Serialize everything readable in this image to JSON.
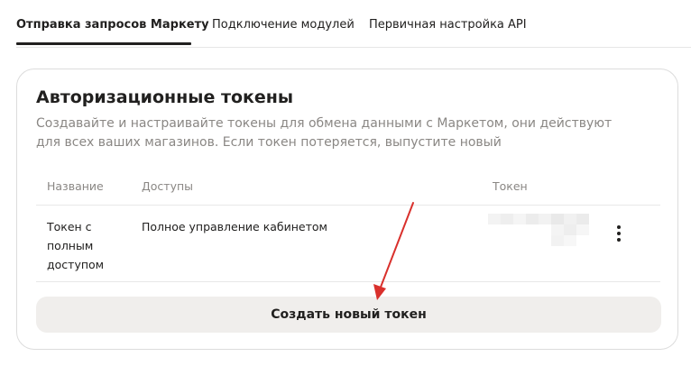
{
  "tabs": [
    {
      "label": "Отправка запросов Маркету",
      "active": true
    },
    {
      "label": "Подключение модулей",
      "active": false
    },
    {
      "label": "Первичная настройка API",
      "active": false
    }
  ],
  "card": {
    "title": "Авторизационные токены",
    "description": "Создавайте и настраивайте токены для обмена данными с Маркетом, они действуют для всех ваших магазинов. Если токен потеряется, выпустите новый"
  },
  "table": {
    "headers": {
      "name": "Название",
      "access": "Доступы",
      "token": "Токен"
    },
    "rows": [
      {
        "name": "Токен с полным доступом",
        "access": "Полное управление кабинетом",
        "token_masked": true
      }
    ]
  },
  "create_button": {
    "label": "Создать новый токен"
  },
  "icons": {
    "row_menu": "more-vertical-icon",
    "annotation": "red-arrow-icon"
  },
  "colors": {
    "annotation": "#d9302c",
    "button_bg": "#f0eeec",
    "muted_text": "#8a8784"
  }
}
